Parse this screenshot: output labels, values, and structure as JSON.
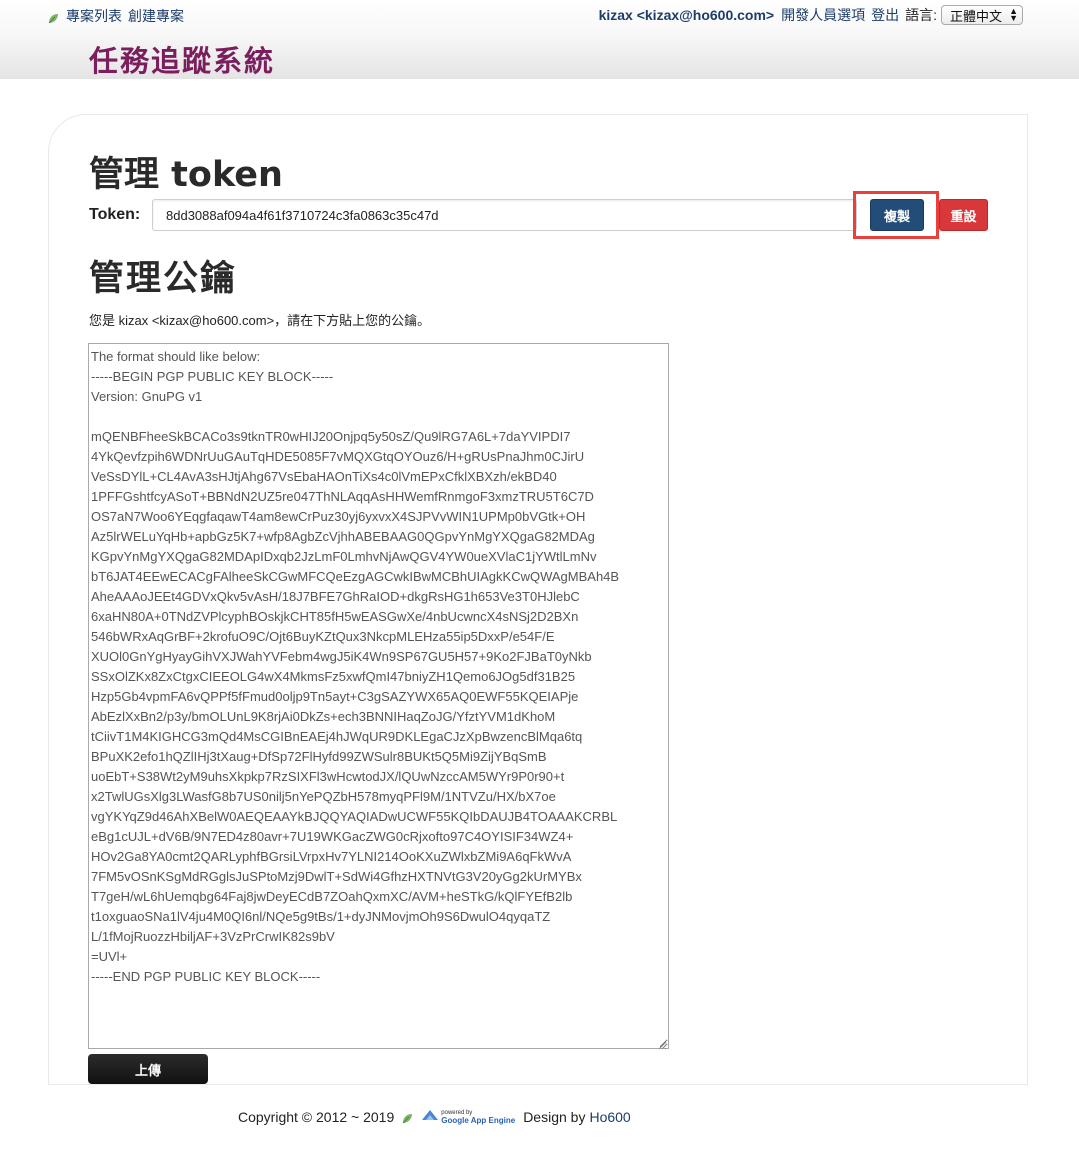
{
  "topnav": {
    "left_items": [
      {
        "label": "專案列表"
      },
      {
        "label": "創建專案"
      }
    ],
    "user": "kizax <kizax@ho600.com>",
    "dev_options": "開發人員選項",
    "logout": "登出",
    "language_label": "語言:",
    "language_selected": "正體中文"
  },
  "site": {
    "title": "任務追蹤系統"
  },
  "token_section": {
    "heading": "管理 token",
    "label": "Token:",
    "value": "8dd3088af094a4f61f3710724c3fa0863c35c47d",
    "copy_label": "複製",
    "reset_label": "重設"
  },
  "key_section": {
    "heading": "管理公鑰",
    "intro": "您是 kizax <kizax@ho600.com>，請在下方貼上您的公鑰。",
    "textarea_value": "The format should like below:\n-----BEGIN PGP PUBLIC KEY BLOCK-----\nVersion: GnuPG v1\n\nmQENBFheeSkBCACo3s9tknTR0wHIJ20Onjpq5y50sZ/Qu9lRG7A6L+7daYVIPDI7\n4YkQevfzpih6WDNrUuGAuTqHDE5085F7vMQXGtqOYOuz6/H+gRUsPnaJhm0CJirU\nVeSsDYlL+CL4AvA3sHJtjAhg67VsEbaHAOnTiXs4c0lVmEPxCfklXBXzh/ekBD40\n1PFFGshtfcyASoT+BBNdN2UZ5re047ThNLAqqAsHHWemfRnmgoF3xmzTRU5T6C7D\nOS7aN7Woo6YEqgfaqawT4am8ewCrPuz30yj6yxvxX4SJPVvWIN1UPMp0bVGtk+OH\nAz5lrWELuYqHb+apbGz5K7+wfp8AgbZcVjhhABEBAAG0QGpvYnMgYXQgaG82MDAg\nKGpvYnMgYXQgaG82MDApIDxqb2JzLmF0LmhvNjAwQGV4YW0ueXVlaC1jYWtlLmNv\nbT6JAT4EEwECACgFAlheeSkCGwMFCQeEzgAGCwkIBwMCBhUIAgkKCwQWAgMBAh4B\nAheAAAoJEEt4GDVxQkv5vAsH/18J7BFE7GhRaIOD+dkgRsHG1h653Ve3T0HJlebC\n6xaHN80A+0TNdZVPlcyphBOskjkCHT85fH5wEASGwXe/4nbUcwncX4sNSj2D2BXn\n546bWRxAqGrBF+2krofuO9C/Ojt6BuyKZtQux3NkcpMLEHza55ip5DxxP/e54F/E\nXUOl0GnYgHyayGihVXJWahYVFebm4wgJ5iK4Wn9SP67GU5H57+9Ko2FJBaT0yNkb\nSSxOlZKx8ZxCtgxCIEEOLG4wX4MkmsFz5xwfQmI47bniyZH1Qemo6JOg5df31B25\nHzp5Gb4vpmFA6vQPPf5fFmud0oljp9Tn5ayt+C3gSAZYWX65AQ0EWF55KQEIAPje\nAbEzlXxBn2/p3y/bmOLUnL9K8rjAi0DkZs+ech3BNNIHaqZoJG/YfztYVM1dKhoM\ntCiivT1M4KIGHCG3mQd4MsCGIBnEAEj4hJWqUR9DKLEgaCJzXpBwzencBlMqa6tq\nBPuXK2efo1hQZlIHj3tXaug+DfSp72FlHyfd99ZWSulr8BUKt5Q5Mi9ZijYBqSmB\nuoEbT+S38Wt2yM9uhsXkpkp7RzSIXFl3wHcwtodJX/lQUwNzccAM5WYr9P0r90+t\nx2TwlUGsXlg3LWasfG8b7US0nilj5nYePQZbH578myqPFl9M/1NTVZu/HX/bX7oe\nvgYKYqZ9d46AhXBelW0AEQEAAYkBJQQYAQIADwUCWF55KQIbDAUJB4TOAAAKCRBL\neBg1cUJL+dV6B/9N7ED4z80avr+7U19WKGacZWG0cRjxofto97C4OYISIF34WZ4+\nHOv2Ga8YA0cmt2QARLyphfBGrsiLVrpxHv7YLNI214OoKXuZWlxbZMi9A6qFkWvA\n7FM5vOSnKSgMdRGglsJuSPtoMzj9DwlT+SdWi4GfhzHXTNVtG3V20yGg2kUrMYBx\nT7geH/wL6hUemqbg64Faj8jwDeyECdB7ZOahQxmXC/AVM+heSTkG/kQlFYEfB2lb\nt1oxguaoSNa1lV4ju4M0QI6nl/NQe5g9tBs/1+dyJNMovjmOh9S6DwulO4qyqaTZ\nL/1fMojRuozzHbiljAF+3VzPrCrwIK82s9bV\n=UVl+\n-----END PGP PUBLIC KEY BLOCK-----",
    "upload_label": "上傳"
  },
  "footer": {
    "copyright": "Copyright © 2012 ~ 2019",
    "gae_small": "powered by",
    "gae_big": "Google App Engine",
    "design_by": "Design by",
    "designer": "Ho600"
  },
  "icons": {
    "leaf": "leaf-icon",
    "gae": "app-engine-icon",
    "select_arrows": "up-down-arrows-icon",
    "resize_grip": "resize-grip-icon"
  },
  "colors": {
    "title": "#7a1e5e",
    "link": "#1c3d6b",
    "copy_button": "#234d78",
    "reset_button": "#d8383a",
    "highlight": "#e8403d",
    "upload_button": "#1a1a1a"
  }
}
